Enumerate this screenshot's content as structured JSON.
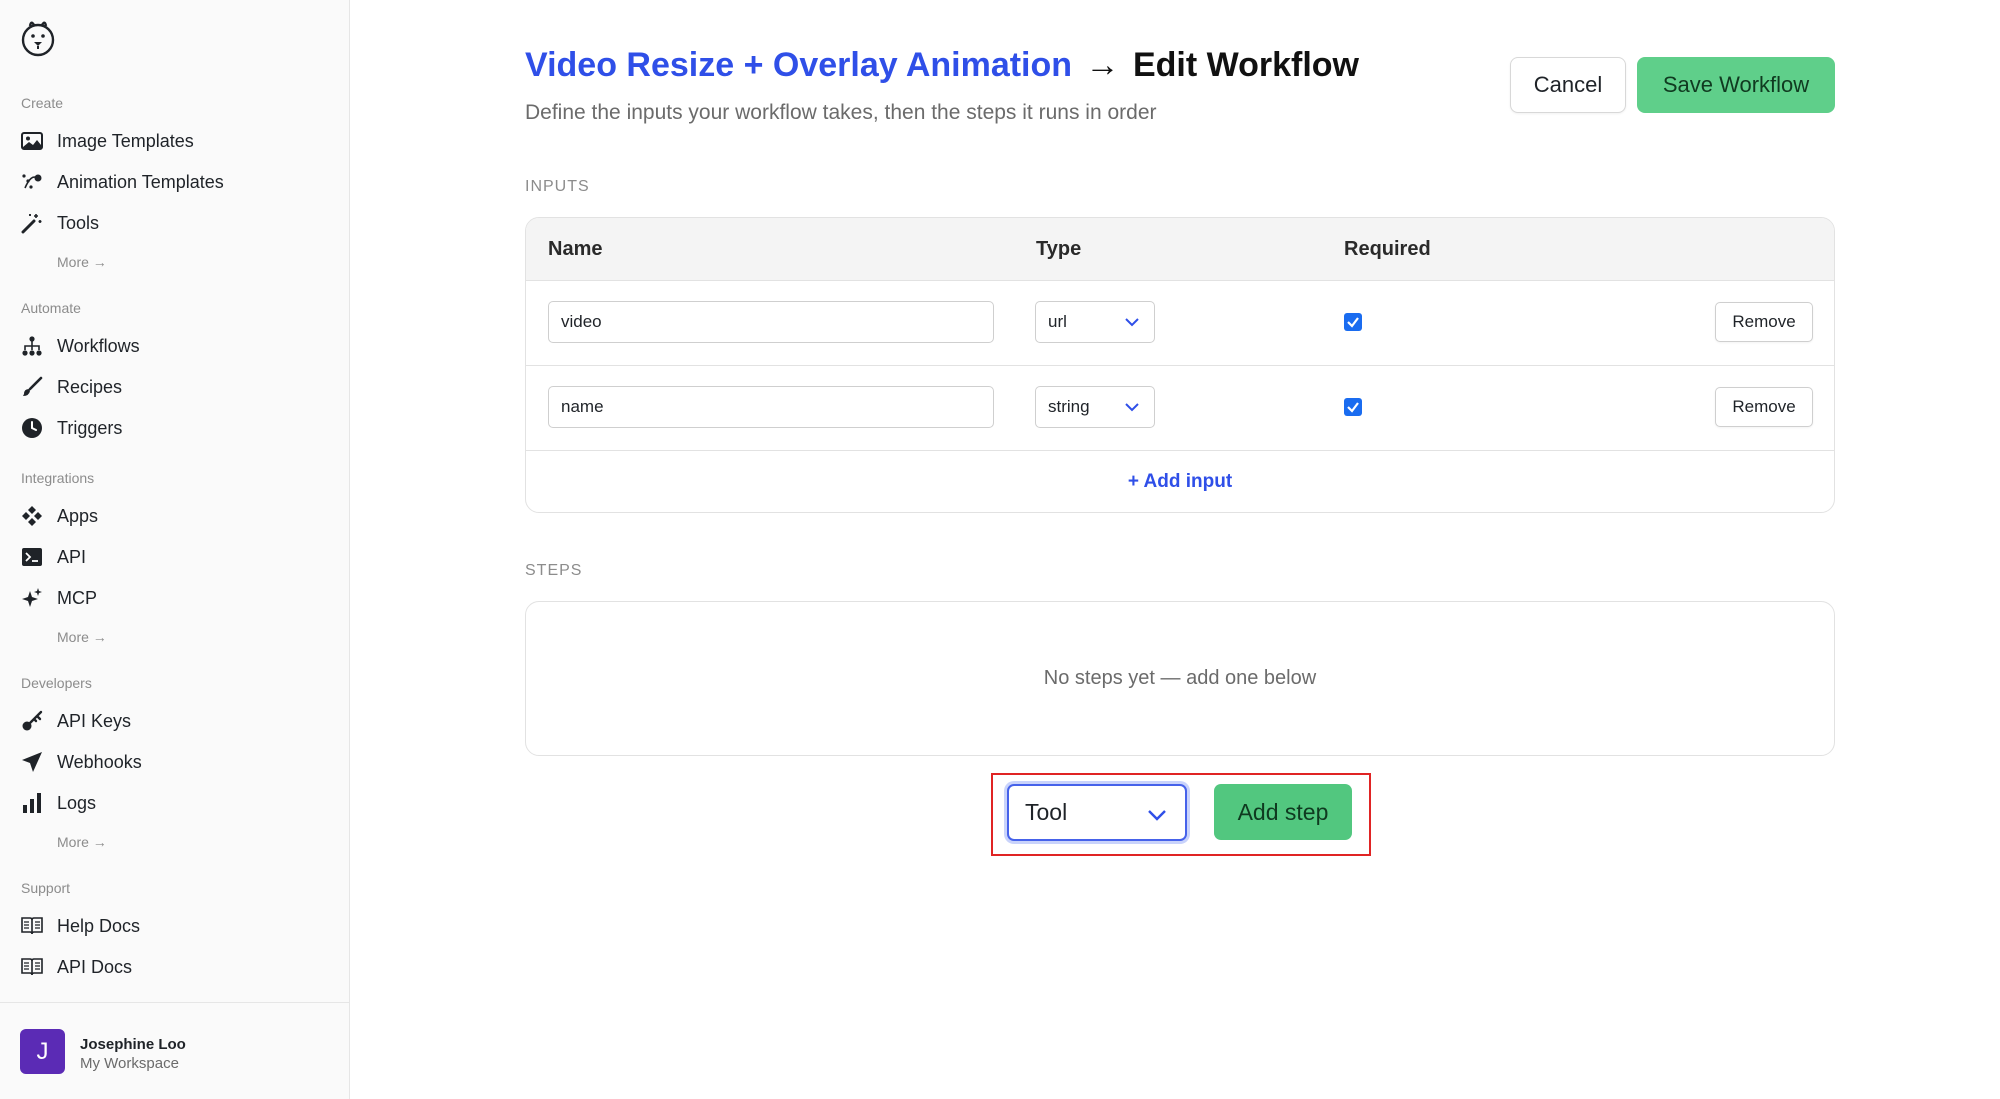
{
  "sidebar": {
    "sections": [
      {
        "label": "Create",
        "items": [
          {
            "label": "Image Templates",
            "icon": "image-icon"
          },
          {
            "label": "Animation Templates",
            "icon": "animation-icon"
          },
          {
            "label": "Tools",
            "icon": "magic-wand-icon"
          }
        ],
        "more": "More →"
      },
      {
        "label": "Automate",
        "items": [
          {
            "label": "Workflows",
            "icon": "workflow-icon"
          },
          {
            "label": "Recipes",
            "icon": "brush-icon"
          },
          {
            "label": "Triggers",
            "icon": "clock-icon"
          }
        ]
      },
      {
        "label": "Integrations",
        "items": [
          {
            "label": "Apps",
            "icon": "apps-icon"
          },
          {
            "label": "API",
            "icon": "terminal-icon"
          },
          {
            "label": "MCP",
            "icon": "sparkle-icon"
          }
        ],
        "more": "More →"
      },
      {
        "label": "Developers",
        "items": [
          {
            "label": "API Keys",
            "icon": "key-icon"
          },
          {
            "label": "Webhooks",
            "icon": "send-icon"
          },
          {
            "label": "Logs",
            "icon": "bar-chart-icon"
          }
        ],
        "more": "More →"
      },
      {
        "label": "Support",
        "items": [
          {
            "label": "Help Docs",
            "icon": "book-icon"
          },
          {
            "label": "API Docs",
            "icon": "book-icon"
          }
        ]
      }
    ],
    "user": {
      "initial": "J",
      "name": "Josephine Loo",
      "workspace": "My Workspace"
    }
  },
  "header": {
    "crumb": "Video Resize + Overlay Animation",
    "arrow": "→",
    "page_title": "Edit Workflow",
    "subtitle": "Define the inputs your workflow takes, then the steps it runs in order",
    "cancel_label": "Cancel",
    "save_label": "Save Workflow"
  },
  "inputs": {
    "section_label": "INPUTS",
    "columns": [
      "Name",
      "Type",
      "Required"
    ],
    "rows": [
      {
        "name": "video",
        "type": "url",
        "required": true,
        "remove_label": "Remove"
      },
      {
        "name": "name",
        "type": "string",
        "required": true,
        "remove_label": "Remove"
      }
    ],
    "add_label": "+ Add input"
  },
  "steps": {
    "section_label": "STEPS",
    "empty_text": "No steps yet — add one below",
    "step_type": "Tool",
    "add_label": "Add step"
  },
  "colors": {
    "accent_blue": "#2f4fe8",
    "save_green": "#5fcf8a",
    "add_step_green": "#52c77f",
    "avatar_purple": "#5b2bb5",
    "highlight_red": "#e02424",
    "checkbox_blue": "#1a6cf0"
  }
}
